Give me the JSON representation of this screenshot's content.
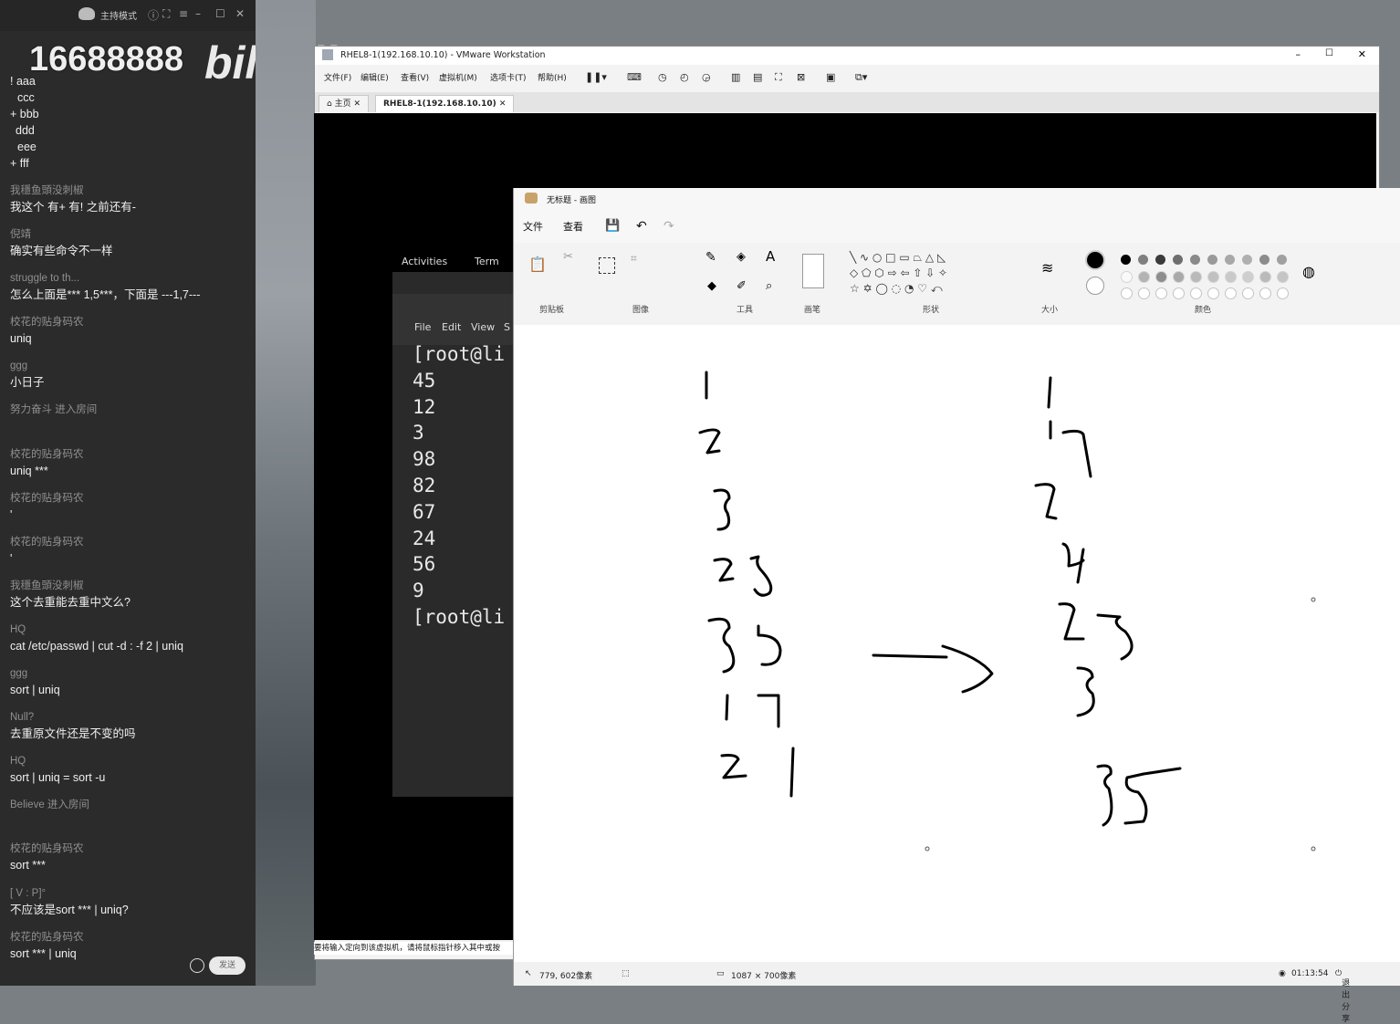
{
  "chat": {
    "window_title": "主持模式",
    "watermark": "16688888",
    "brand": "bilibili",
    "preamble": [
      "! aaa",
      "ccc",
      "+ bbb",
      "ddd",
      "eee",
      "+ fff"
    ],
    "messages": [
      {
        "name": "我穩鱼頭没刺椒",
        "text": "我这个 有+ 有!   之前还有-"
      },
      {
        "name": "倪靖",
        "text": "确实有些命令不一样"
      },
      {
        "name": "struggle to th...",
        "text": "怎么上面是*** 1,5***，下面是 ---1,7---"
      },
      {
        "name": "校花的贴身码农",
        "text": "uniq"
      },
      {
        "name": "ggg",
        "text": "小日子"
      },
      {
        "name": "努力奋斗 进入房间",
        "text": ""
      },
      {
        "name": "校花的贴身码农",
        "text": "uniq ***"
      },
      {
        "name": "校花的贴身码农",
        "text": "'"
      },
      {
        "name": "校花的贴身码农",
        "text": "'"
      },
      {
        "name": "我穩鱼頭没刺椒",
        "text": "这个去重能去重中文么?"
      },
      {
        "name": "HQ",
        "text": "cat /etc/passwd | cut -d : -f 2 | uniq"
      },
      {
        "name": "ggg",
        "text": "sort | uniq"
      },
      {
        "name": "Null?",
        "text": "去重原文件还是不变的吗"
      },
      {
        "name": "HQ",
        "text": "sort | uniq = sort -u"
      },
      {
        "name": "Believe 进入房间",
        "text": ""
      },
      {
        "name": "校花的贴身码农",
        "text": "sort ***"
      },
      {
        "name": "[     V      :       P]°",
        "text": "不应该是sort *** | uniq?"
      },
      {
        "name": "校花的贴身码农",
        "text": "sort *** | uniq"
      }
    ],
    "send_label": "发送"
  },
  "vmware": {
    "title": "RHEL8-1(192.168.10.10) - VMware Workstation",
    "menu": [
      "文件(F)",
      "编辑(E)",
      "查看(V)",
      "虚拟机(M)",
      "选项卡(T)",
      "帮助(H)"
    ],
    "tabs": [
      "主页",
      "RHEL8-1(192.168.10.10)"
    ],
    "status": "要将输入定向到该虚拟机，请将鼠标指针移入其中或按",
    "gnome": {
      "activities": "Activities",
      "app": "Term"
    },
    "terminal": {
      "menu": [
        "File",
        "Edit",
        "View",
        "S"
      ],
      "lines": [
        "[root@li",
        "45",
        "12",
        "3",
        "98",
        "82",
        "67",
        "24",
        "56",
        "9",
        "[root@li"
      ]
    }
  },
  "paint": {
    "title": "无标题 - 画图",
    "menu": [
      "文件",
      "查看"
    ],
    "groups": [
      "剪贴板",
      "图像",
      "工具",
      "画笔",
      "形状",
      "大小",
      "颜色"
    ],
    "status": {
      "cursor": "779, 602像素",
      "size": "1087 × 700像素",
      "timer": "01:13:54",
      "exit_share": "退出分享"
    },
    "colors": [
      "#000000",
      "#7f7f7f",
      "#3a3a3a",
      "#6e6e6e",
      "#8a8a8a",
      "#9a9a9a",
      "#a8a8a8",
      "#b0b0b0",
      "#8c8c8c",
      "#a0a0a0"
    ]
  }
}
